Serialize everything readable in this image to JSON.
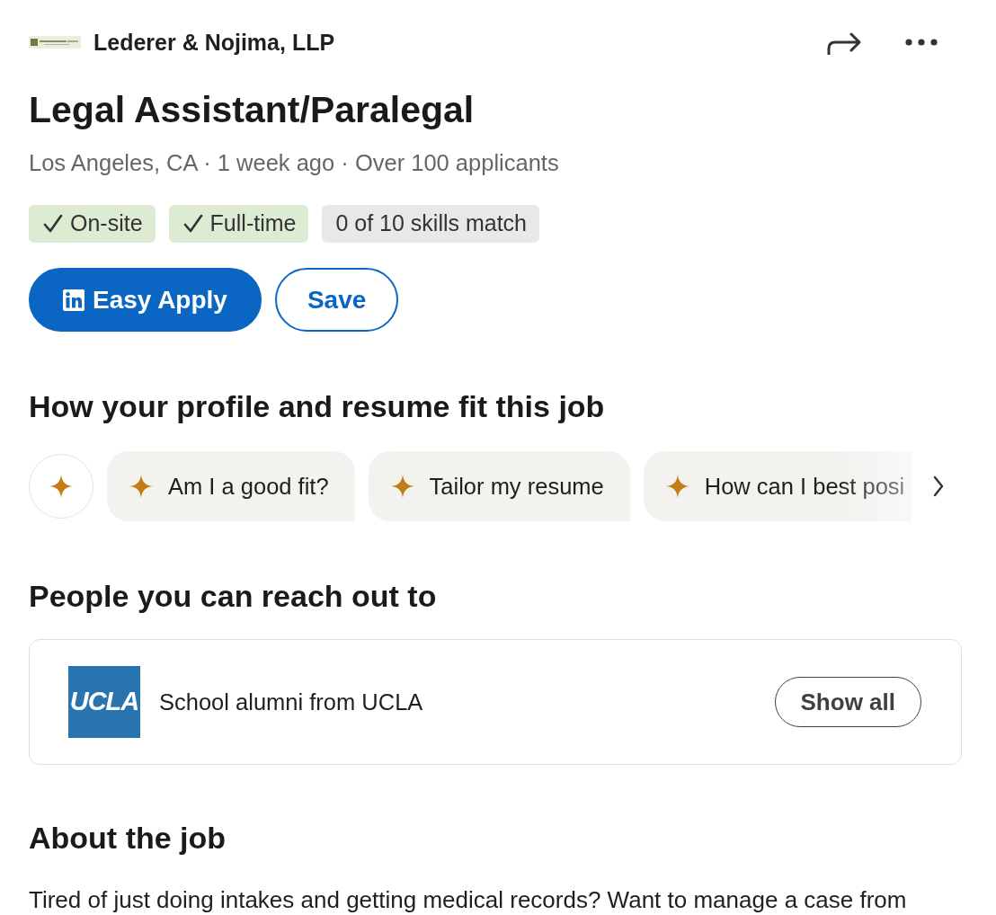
{
  "company": {
    "name": "Lederer & Nojima, LLP"
  },
  "job": {
    "title": "Legal Assistant/Paralegal",
    "meta": "Los Angeles, CA · 1 week ago · Over 100 applicants"
  },
  "tags": [
    {
      "label": "On-site",
      "kind": "match"
    },
    {
      "label": "Full-time",
      "kind": "match"
    },
    {
      "label": "0 of 10 skills match",
      "kind": "info"
    }
  ],
  "actions": [
    {
      "label": "Easy Apply",
      "kind": "primary"
    },
    {
      "label": "Save",
      "kind": "secondary"
    }
  ],
  "fit_section": {
    "heading": "How your profile and resume fit this job",
    "prompts": [
      {
        "label": "Am I a good fit?"
      },
      {
        "label": "Tailor my resume"
      },
      {
        "label": "How can I best posi"
      }
    ]
  },
  "people_section": {
    "heading": "People you can reach out to",
    "connections": [
      {
        "logo_text": "UCLA",
        "label": "School alumni from UCLA",
        "button": "Show all"
      }
    ]
  },
  "about": {
    "heading": "About the job",
    "text": "Tired of just doing intakes and getting medical records? Want to manage a case from"
  }
}
